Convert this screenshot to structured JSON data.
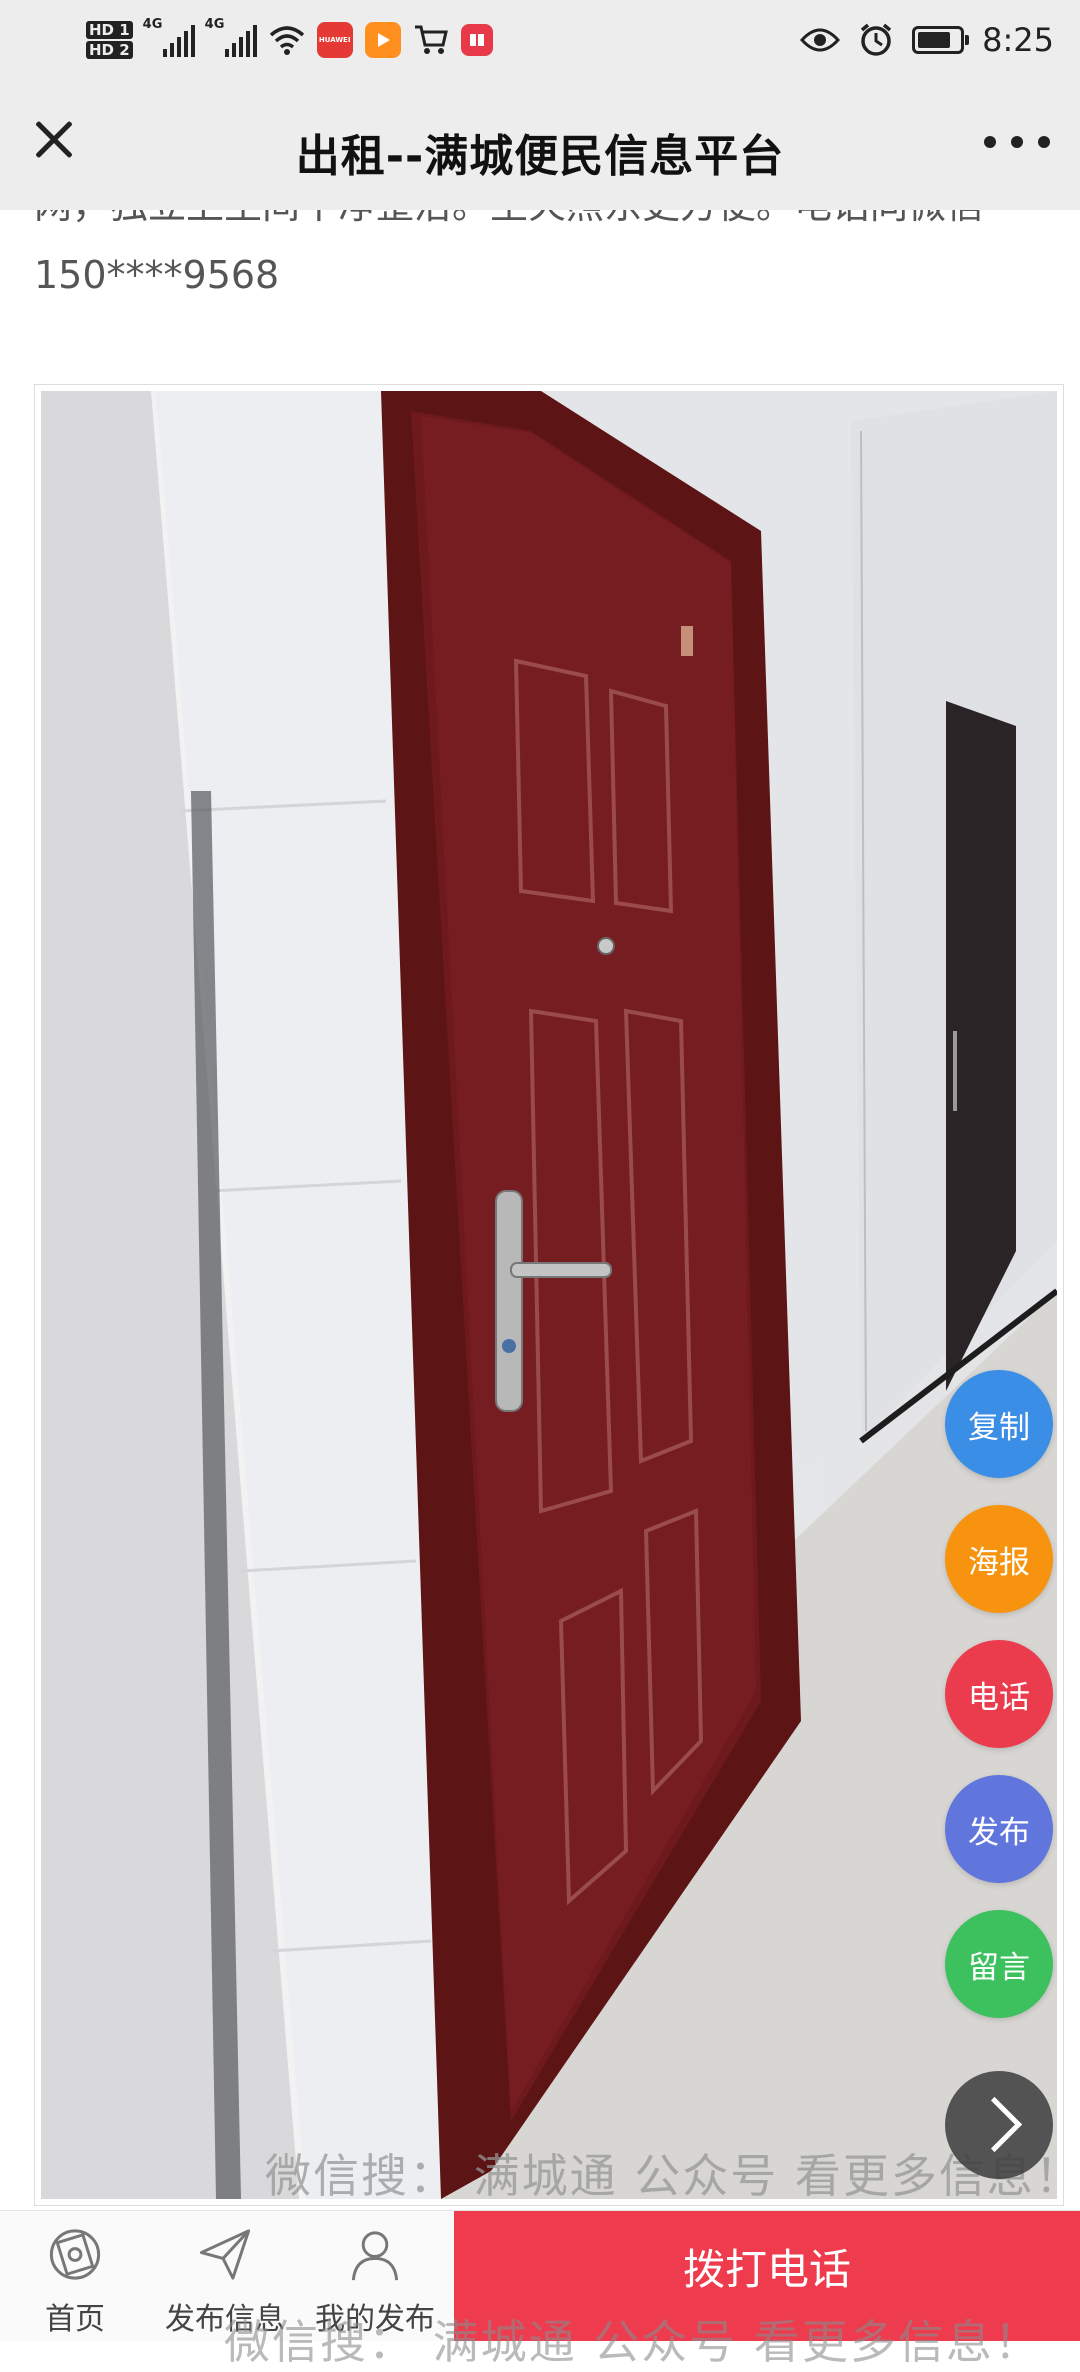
{
  "status_bar": {
    "sim1": "HD 1",
    "sim2": "HD 2",
    "net1": "4G",
    "net2": "4G",
    "app_icon_1": "HUAWEI",
    "time": "8:25",
    "battery_level": 0.8
  },
  "header": {
    "title": "出租--满城便民信息平台",
    "close_icon": "close-icon",
    "more_icon": "more-icon"
  },
  "article": {
    "cut_line": "网，独立卫生间干净整洁。生火照东更方便。电话同微信",
    "phone": "150****9568"
  },
  "photo": {
    "watermark": "微信搜： 满城通 公众号 看更多信息！"
  },
  "fabs": [
    {
      "label": "复制",
      "color": "#3a8ee6"
    },
    {
      "label": "海报",
      "color": "#f7930f"
    },
    {
      "label": "电话",
      "color": "#ea3c4d"
    },
    {
      "label": "发布",
      "color": "#6176dc"
    },
    {
      "label": "留言",
      "color": "#3dc05e"
    }
  ],
  "next_icon": "chevron-right-icon",
  "bottom_nav": [
    {
      "label": "首页",
      "icon": "home-icon"
    },
    {
      "label": "发布信息",
      "icon": "send-icon"
    },
    {
      "label": "我的发布",
      "icon": "user-icon"
    }
  ],
  "call_button": "拨打电话",
  "bottom_watermark": "微信搜： 满城通 公众号 看更多信息！"
}
